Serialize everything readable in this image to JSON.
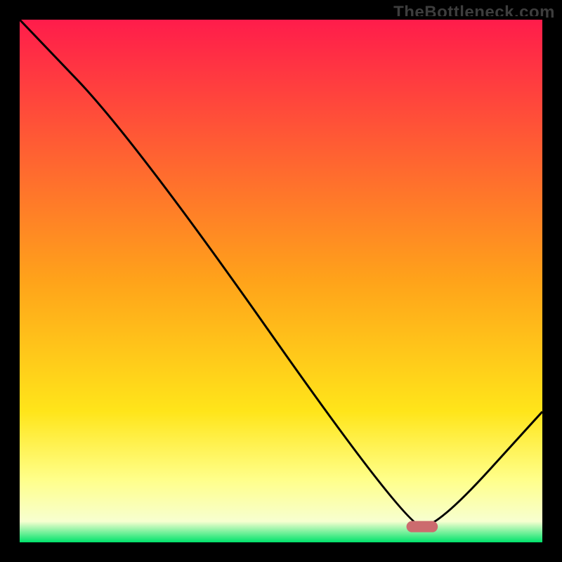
{
  "watermark": "TheBottleneck.com",
  "chart_data": {
    "type": "line",
    "title": "",
    "xlabel": "",
    "ylabel": "",
    "xlim": [
      0,
      100
    ],
    "ylim": [
      0,
      100
    ],
    "x": [
      0,
      22,
      74,
      80,
      100
    ],
    "values": [
      100,
      77,
      3,
      3,
      25
    ],
    "marker_segment": {
      "x0": 74,
      "x1": 80,
      "y": 3
    },
    "colors": {
      "curve": "#000000",
      "marker": "#cc6b6e",
      "gradient_stops": [
        {
          "offset": 0.0,
          "color": "#ff1c4b"
        },
        {
          "offset": 0.5,
          "color": "#ffa31a"
        },
        {
          "offset": 0.75,
          "color": "#ffe51a"
        },
        {
          "offset": 0.88,
          "color": "#ffff8a"
        },
        {
          "offset": 0.96,
          "color": "#f7ffd0"
        },
        {
          "offset": 1.0,
          "color": "#00e36b"
        }
      ]
    }
  }
}
